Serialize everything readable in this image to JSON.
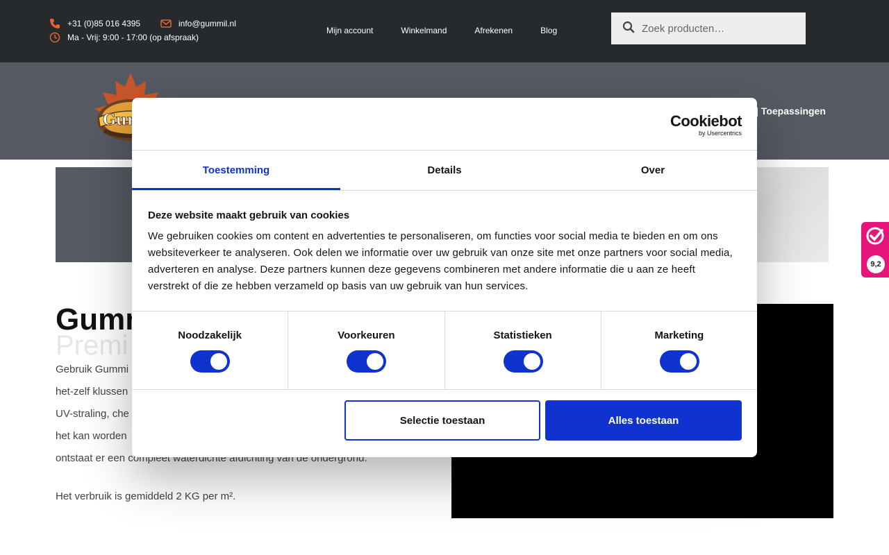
{
  "topbar": {
    "phone": "+31 (0)85 016 4395",
    "email": "info@gummil.nl",
    "hours": "Ma - Vrij: 9:00 - 17:00 (op afspraak)",
    "nav": [
      "Mijn account",
      "Winkelmand",
      "Afrekenen",
      "Blog"
    ],
    "search_placeholder": "Zoek producten…",
    "accent_color": "#e8642c"
  },
  "header": {
    "nav_partial": "| Toepassingen",
    "logo_text": "Gum"
  },
  "content": {
    "title_partial": "Gumm",
    "subtitle_partial": "Premi",
    "para_lines": [
      "Gebruik Gummi",
      "het-zelf klussen",
      "UV-straling, che",
      "het kan worden",
      "ontstaat er een compleet waterdichte afdichting van de ondergrond."
    ],
    "usage": "Het verbruik is gemiddeld 2 KG per m²."
  },
  "rating": {
    "score": "9,2",
    "color": "#e5157b"
  },
  "cookie": {
    "brand": "Cookiebot",
    "brand_sub": "by Usercentrics",
    "tabs": [
      "Toestemming",
      "Details",
      "Over"
    ],
    "heading": "Deze website maakt gebruik van cookies",
    "body": "We gebruiken cookies om content en advertenties te personaliseren, om functies voor social media te bieden en om ons websiteverkeer te analyseren. Ook delen we informatie over uw gebruik van onze site met onze partners voor social media, adverteren en analyse. Deze partners kunnen deze gegevens combineren met andere informatie die u aan ze heeft verstrekt of die ze hebben verzameld op basis van uw gebruik van hun services.",
    "categories": [
      {
        "label": "Noodzakelijk",
        "checked": true
      },
      {
        "label": "Voorkeuren",
        "checked": true
      },
      {
        "label": "Statistieken",
        "checked": true
      },
      {
        "label": "Marketing",
        "checked": true
      }
    ],
    "btn_selection": "Selectie toestaan",
    "btn_all": "Alles toestaan",
    "accent_color": "#1032cf"
  }
}
